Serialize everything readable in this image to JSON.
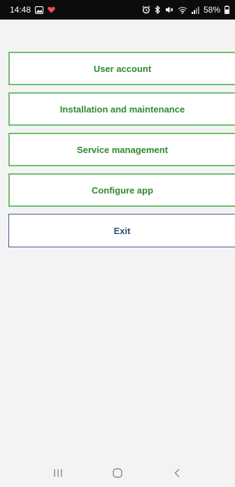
{
  "status_bar": {
    "time": "14:48",
    "battery": "58%",
    "colors": {
      "background": "#0c0c0c",
      "text": "#ffffff"
    },
    "icons": [
      "gallery-icon",
      "heart-icon",
      "alarm-icon",
      "bluetooth-icon",
      "mute-icon",
      "wifi-icon",
      "signal-icon",
      "battery-icon"
    ]
  },
  "menu": {
    "items": [
      {
        "label": "User account"
      },
      {
        "label": "Installation and maintenance"
      },
      {
        "label": "Service management"
      },
      {
        "label": "Configure app"
      }
    ],
    "exit_label": "Exit"
  },
  "nav_bar": {
    "icons": [
      "recent-apps-icon",
      "home-icon",
      "back-icon"
    ]
  },
  "colors": {
    "menu_border": "#6cc06c",
    "menu_text": "#2f8a2f",
    "exit_border": "#3a5f8c",
    "exit_text": "#2d4f79",
    "background": "#f3f3f3"
  }
}
